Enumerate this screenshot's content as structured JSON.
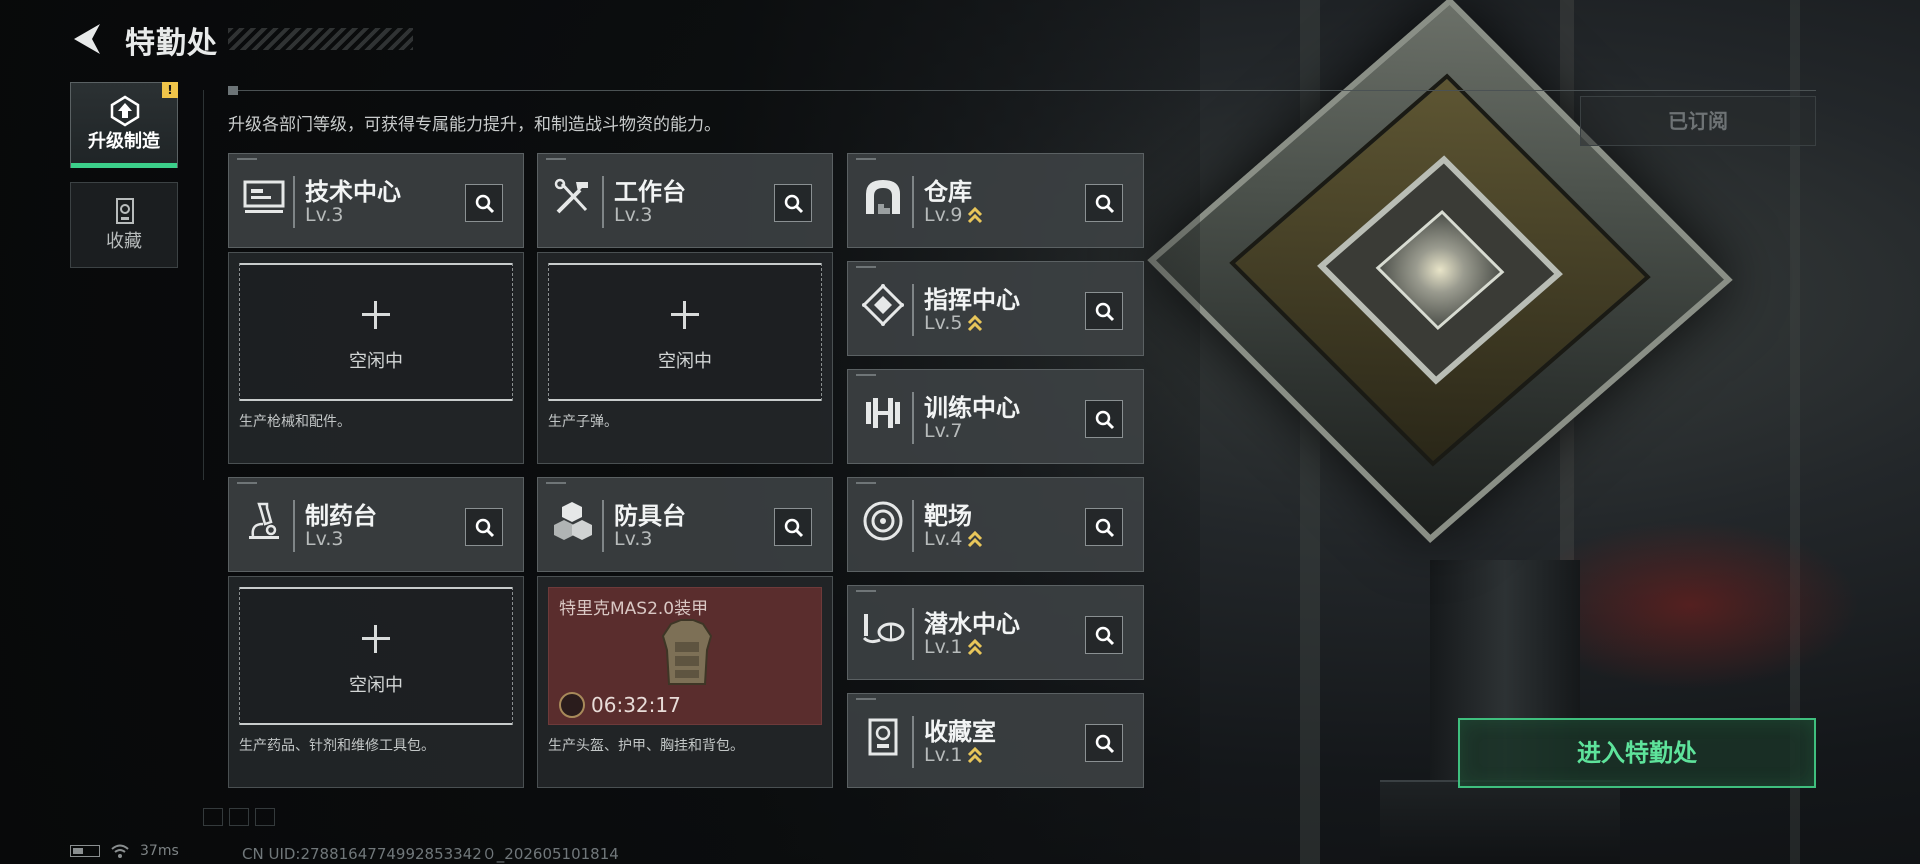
{
  "header": {
    "title": "特勤处"
  },
  "nav": {
    "items": [
      {
        "label": "升级制造",
        "active": true,
        "badge": "!"
      },
      {
        "label": "收藏",
        "active": false
      }
    ]
  },
  "description": "升级各部门等级，可获得专属能力提升，和制造战斗物资的能力。",
  "subscribed_label": "已订阅",
  "departments": {
    "tech": {
      "name": "技术中心",
      "level": "Lv.3",
      "icon": "computer-icon",
      "slot_status": "空闲中",
      "desc": "生产枪械和配件。"
    },
    "workbench": {
      "name": "工作台",
      "level": "Lv.3",
      "icon": "tools-icon",
      "slot_status": "空闲中",
      "desc": "生产子弹。"
    },
    "pharmacy": {
      "name": "制药台",
      "level": "Lv.3",
      "icon": "microscope-icon",
      "slot_status": "空闲中",
      "desc": "生产药品、针剂和维修工具包。"
    },
    "armor": {
      "name": "防具台",
      "level": "Lv.3",
      "icon": "cubes-icon",
      "desc": "生产头盔、护甲、胸挂和背包。",
      "crafting": {
        "item": "特里克MAS2.0装甲",
        "timer": "06:32:17"
      }
    },
    "warehouse": {
      "name": "仓库",
      "level": "Lv.9",
      "upgradable": true,
      "icon": "warehouse-icon"
    },
    "command": {
      "name": "指挥中心",
      "level": "Lv.5",
      "upgradable": true,
      "icon": "chip-icon"
    },
    "training": {
      "name": "训练中心",
      "level": "Lv.7",
      "upgradable": false,
      "icon": "dumbbell-icon"
    },
    "range": {
      "name": "靶场",
      "level": "Lv.4",
      "upgradable": true,
      "icon": "target-icon"
    },
    "diving": {
      "name": "潜水中心",
      "level": "Lv.1",
      "upgradable": true,
      "icon": "diving-mask-icon"
    },
    "collection": {
      "name": "收藏室",
      "level": "Lv.1",
      "upgradable": true,
      "icon": "trophy-icon"
    }
  },
  "enter_button": "进入特勤处",
  "status": {
    "ping": "37ms",
    "uid": "CN UID:2788164774992853342０_202605101814"
  },
  "colors": {
    "accent_green": "#3fbf7e",
    "upgrade_yellow": "#e8c65a",
    "craft_red": "#5a2d2d"
  }
}
